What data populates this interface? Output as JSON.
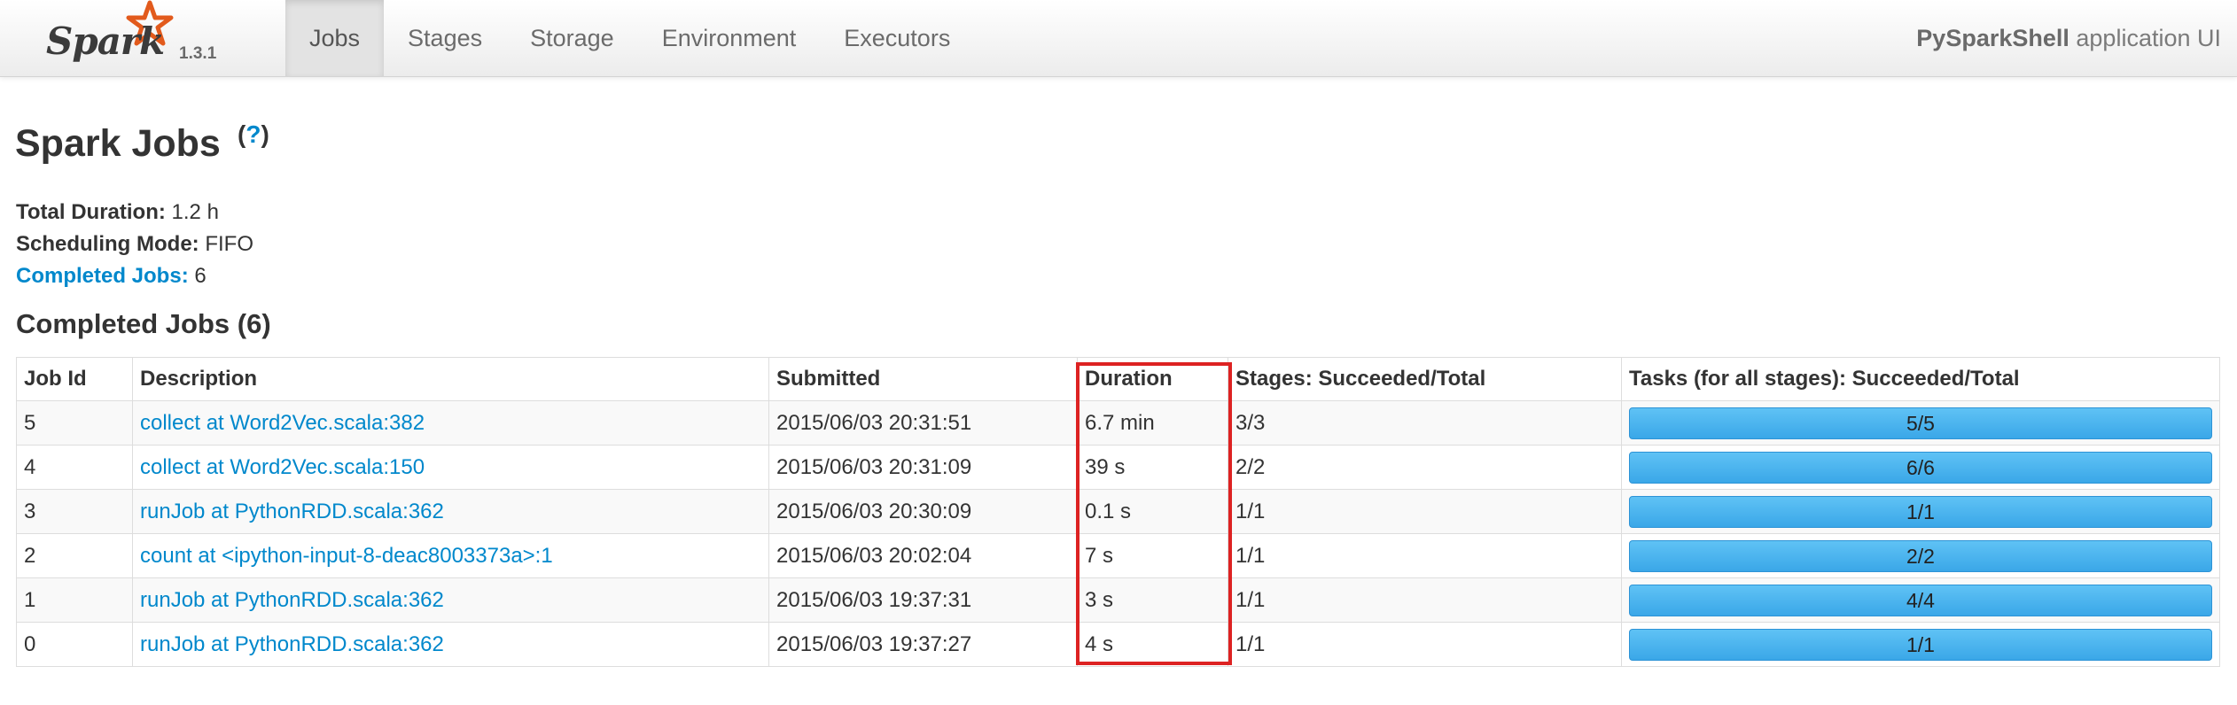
{
  "brand": {
    "logo": "Spark",
    "version": "1.3.1"
  },
  "nav": {
    "tabs": [
      {
        "label": "Jobs",
        "active": true
      },
      {
        "label": "Stages",
        "active": false
      },
      {
        "label": "Storage",
        "active": false
      },
      {
        "label": "Environment",
        "active": false
      },
      {
        "label": "Executors",
        "active": false
      }
    ],
    "app_name": "PySparkShell",
    "app_suffix": " application UI"
  },
  "page": {
    "title": "Spark Jobs",
    "help": "?",
    "summary": {
      "total_duration_label": "Total Duration:",
      "total_duration_value": " 1.2 h",
      "scheduling_mode_label": "Scheduling Mode:",
      "scheduling_mode_value": " FIFO",
      "completed_jobs_label": "Completed Jobs:",
      "completed_jobs_value": " 6"
    },
    "section_title": "Completed Jobs (6)"
  },
  "table": {
    "headers": [
      "Job Id",
      "Description",
      "Submitted",
      "Duration",
      "Stages: Succeeded/Total",
      "Tasks (for all stages): Succeeded/Total"
    ],
    "rows": [
      {
        "id": "5",
        "desc": "collect at Word2Vec.scala:382",
        "submitted": "2015/06/03 20:31:51",
        "duration": "6.7 min",
        "stages": "3/3",
        "tasks": "5/5"
      },
      {
        "id": "4",
        "desc": "collect at Word2Vec.scala:150",
        "submitted": "2015/06/03 20:31:09",
        "duration": "39 s",
        "stages": "2/2",
        "tasks": "6/6"
      },
      {
        "id": "3",
        "desc": "runJob at PythonRDD.scala:362",
        "submitted": "2015/06/03 20:30:09",
        "duration": "0.1 s",
        "stages": "1/1",
        "tasks": "1/1"
      },
      {
        "id": "2",
        "desc": "count at <ipython-input-8-deac8003373a>:1",
        "submitted": "2015/06/03 20:02:04",
        "duration": "7 s",
        "stages": "1/1",
        "tasks": "2/2"
      },
      {
        "id": "1",
        "desc": "runJob at PythonRDD.scala:362",
        "submitted": "2015/06/03 19:37:31",
        "duration": "3 s",
        "stages": "1/1",
        "tasks": "4/4"
      },
      {
        "id": "0",
        "desc": "runJob at PythonRDD.scala:362",
        "submitted": "2015/06/03 19:37:27",
        "duration": "4 s",
        "stages": "1/1",
        "tasks": "1/1"
      }
    ]
  },
  "colors": {
    "link": "#0088cc",
    "progress": "#3aa7e8",
    "highlight": "#dd2222",
    "spark_star": "#e25a1c"
  }
}
